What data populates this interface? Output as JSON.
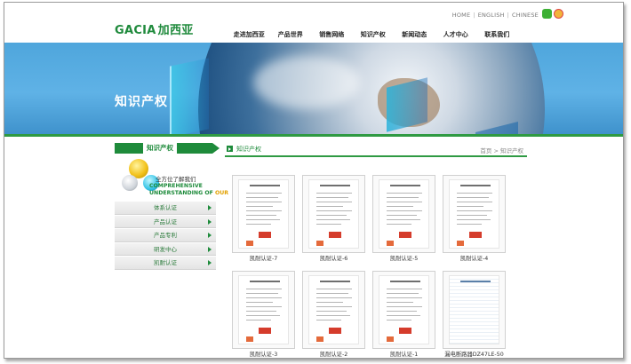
{
  "header": {
    "lang_links": [
      "HOME",
      "ENGLISH",
      "CHINESE"
    ],
    "logo_text": "GACIA",
    "logo_cn": "加西亚",
    "nav": [
      "走进加西亚",
      "产品世界",
      "销售网络",
      "知识产权",
      "新闻动态",
      "人才中心",
      "联系我们"
    ]
  },
  "banner": {
    "title": "知识产权"
  },
  "sidebar": {
    "heading": "知识产权",
    "tagline_cn": "全方位了解我们",
    "tagline_en_1": "COMPREHENSIVE",
    "tagline_en_2": "UNDERSTANDING OF",
    "tagline_en_accent": "OUR",
    "items": [
      {
        "label": "体系认证"
      },
      {
        "label": "产品认证"
      },
      {
        "label": "产品专利"
      },
      {
        "label": "研发中心"
      },
      {
        "label": "凯耐认证"
      }
    ]
  },
  "main": {
    "title": "知识产权",
    "breadcrumb": "首页 > 知识产权",
    "certificates": [
      {
        "caption": "凯耐认证-7"
      },
      {
        "caption": "凯耐认证-6"
      },
      {
        "caption": "凯耐认证-5"
      },
      {
        "caption": "凯耐认证-4"
      },
      {
        "caption": "凯耐认证-3"
      },
      {
        "caption": "凯耐认证-2"
      },
      {
        "caption": "凯耐认证-1"
      },
      {
        "caption": "漏电断路器DZ47LE-50"
      }
    ]
  },
  "colors": {
    "brand_green": "#1e8b3b",
    "banner_blue": "#4fa6dc"
  }
}
